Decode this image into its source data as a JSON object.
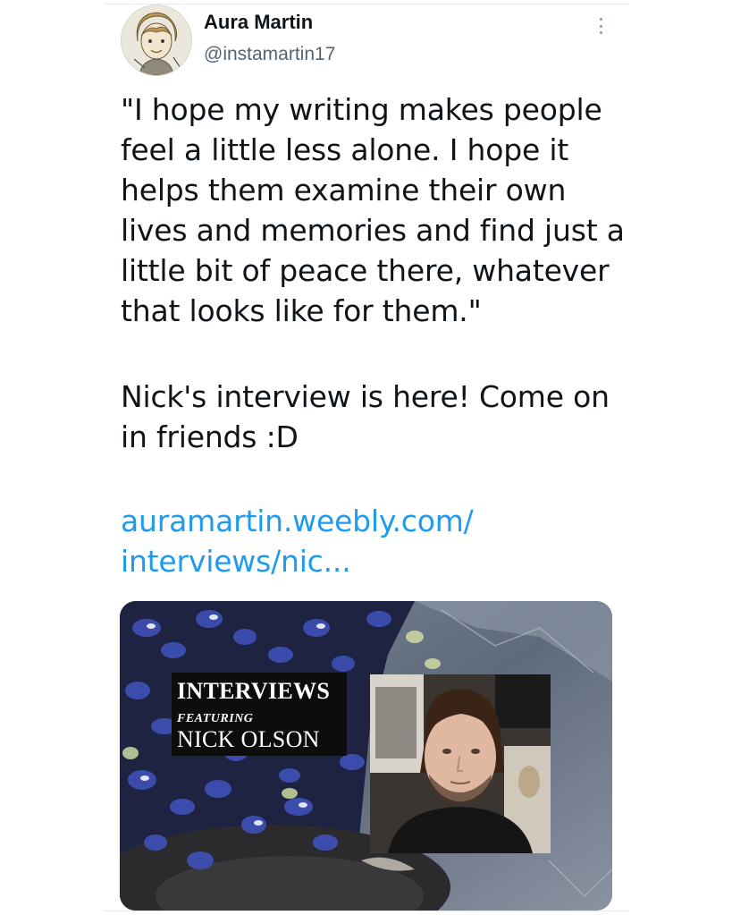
{
  "tweet": {
    "author": {
      "display_name": "Aura Martin",
      "handle": "@instamartin17"
    },
    "text_quote": "\"I hope my writing makes people feel a little less alone. I hope it helps them examine their own lives and memories and find just a little bit of peace there, whatever that looks like for them.\"",
    "text_interview": "Nick's interview is here! Come on in friends :D",
    "link": {
      "line1": "auramartin.weebly.com/",
      "line2": "interviews/nic..."
    },
    "media": {
      "title": "INTERVIEWS",
      "featuring": "FEATURING",
      "name": "NICK OLSON"
    }
  },
  "colors": {
    "text": "#0f1419",
    "secondary": "#536471",
    "link": "#1d9bf0"
  }
}
